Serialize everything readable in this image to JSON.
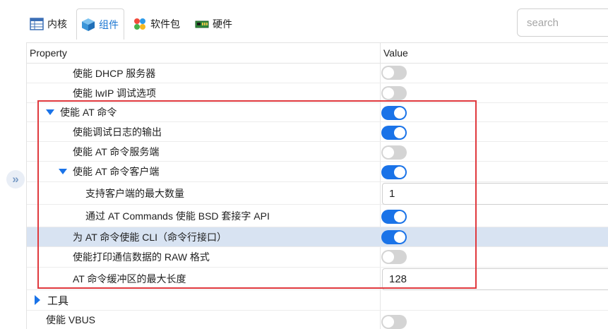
{
  "tabs": [
    {
      "label": "内核",
      "icon": "kernel-icon"
    },
    {
      "label": "组件",
      "icon": "component-cube-icon",
      "active": true
    },
    {
      "label": "软件包",
      "icon": "packages-icon"
    },
    {
      "label": "硬件",
      "icon": "hardware-board-icon"
    }
  ],
  "search": {
    "placeholder": "search"
  },
  "table": {
    "headers": {
      "property": "Property",
      "value": "Value"
    },
    "rows": [
      {
        "label": "使能 DHCP 服务器",
        "type": "toggle",
        "on": false
      },
      {
        "label": "使能 lwIP 调试选项",
        "type": "toggle",
        "on": false
      },
      {
        "label": "使能 AT 命令",
        "type": "toggle",
        "on": true,
        "expanded": true
      },
      {
        "label": "使能调试日志的输出",
        "type": "toggle",
        "on": true
      },
      {
        "label": "使能 AT 命令服务端",
        "type": "toggle",
        "on": false
      },
      {
        "label": "使能 AT 命令客户端",
        "type": "toggle",
        "on": true,
        "expanded": true
      },
      {
        "label": "支持客户端的最大数量",
        "type": "number",
        "value": "1"
      },
      {
        "label": "通过 AT Commands 使能 BSD 套接字 API",
        "type": "toggle",
        "on": true
      },
      {
        "label": "为 AT 命令使能 CLI（命令行接口）",
        "type": "toggle",
        "on": true,
        "selected": true
      },
      {
        "label": "使能打印通信数据的 RAW 格式",
        "type": "toggle",
        "on": false
      },
      {
        "label": "AT 命令缓冲区的最大长度",
        "type": "number",
        "value": "128"
      },
      {
        "label": "工具",
        "type": "group",
        "expanded": false
      },
      {
        "label": "使能 VBUS",
        "type": "toggle",
        "on": false
      }
    ]
  },
  "colors": {
    "accent": "#1a73e8",
    "highlight_border": "#e0393e",
    "selected_row": "#d8e3f2"
  }
}
